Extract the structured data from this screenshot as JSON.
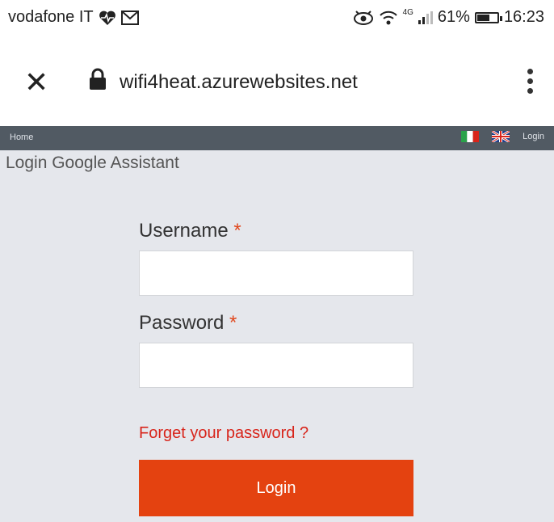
{
  "status_bar": {
    "carrier": "vodafone IT",
    "network": "4G",
    "battery": "61%",
    "battery_level": 0.61,
    "time": "16:23",
    "icons": [
      "heart-monitor-icon",
      "mail-icon",
      "eye-icon",
      "wifi-icon",
      "signal-icon",
      "battery-icon"
    ]
  },
  "browser": {
    "url": "wifi4heat.azurewebsites.net",
    "close_glyph": "✕",
    "icons": [
      "close-icon",
      "lock-icon",
      "more-vert-icon"
    ]
  },
  "nav": {
    "home": "Home",
    "login": "Login",
    "flags": [
      "italian-flag-icon",
      "uk-flag-icon"
    ],
    "colors": {
      "bar": "#515a63"
    }
  },
  "page": {
    "title": "Login Google Assistant",
    "username_label": "Username",
    "password_label": "Password",
    "required_mark": "*",
    "username_value": "",
    "password_value": "",
    "forgot_link": "Forget your password ?",
    "login_button": "Login",
    "colors": {
      "accent": "#e44210",
      "link": "#d8251b",
      "background": "#e5e7ec"
    }
  }
}
